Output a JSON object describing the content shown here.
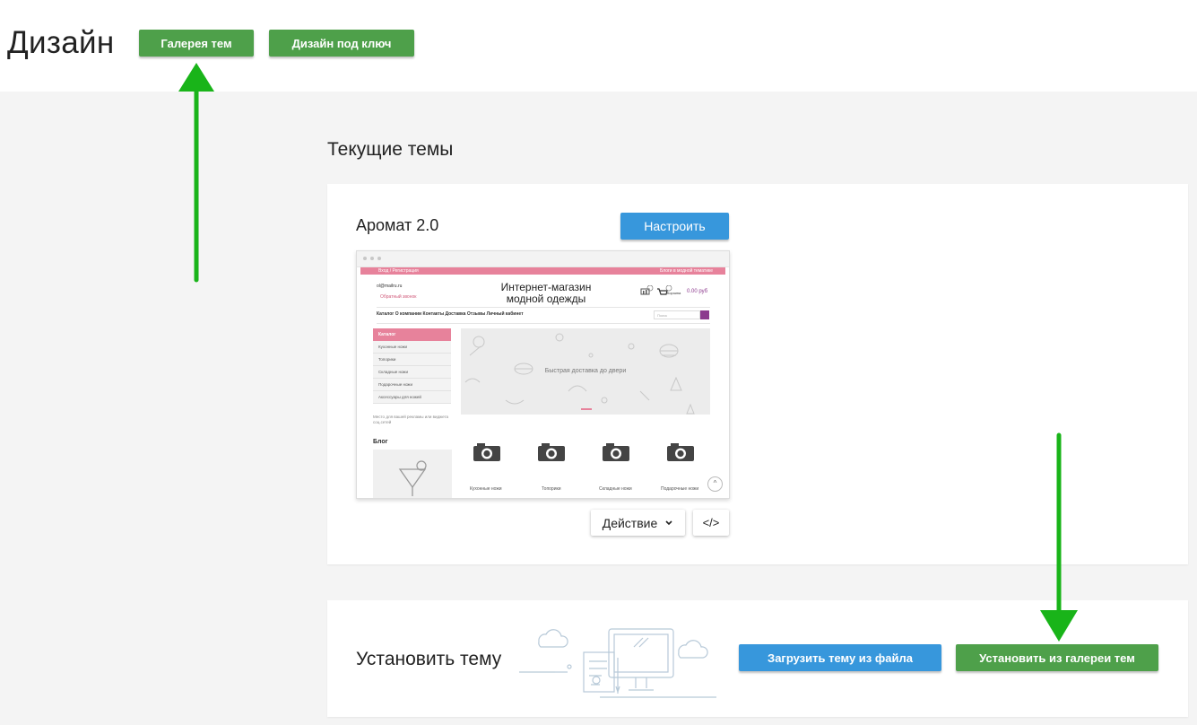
{
  "header": {
    "title": "Дизайн",
    "gallery_button": "Галерея тем",
    "turnkey_button": "Дизайн под ключ"
  },
  "current_themes": {
    "section_title": "Текущие темы",
    "theme_name": "Аромат 2.0",
    "configure_button": "Настроить",
    "action_button": "Действие",
    "code_button": "</>",
    "preview": {
      "topbar_left": "Вход / Регистрация",
      "topbar_right": "Блоги в модной тематике",
      "email": "ol@mailru.ru",
      "callback": "Обратный звонок",
      "shop_title": "Интернет-магазин модной одежды",
      "cart_label": "Корзина",
      "cart_total": "0.00 руб",
      "menu": "Каталог   О компании   Контакты   Доставка   Отзывы   Личный кабинет",
      "search_placeholder": "Поиск",
      "catalog_head": "Каталог",
      "categories": [
        "Кухонные ножи",
        "Топорики",
        "Складные ножи",
        "Подарочные ножи",
        "Аксессуары для ножей"
      ],
      "banner_text": "Быстрая доставка до двери",
      "ad_text": "Место для вашей рекламы или виджета соц.сетей",
      "blog_title": "Блог",
      "products": [
        "Кухонные ножи",
        "Топорики",
        "Складные ножи",
        "Подарочные ножи"
      ]
    }
  },
  "install": {
    "title": "Установить тему",
    "upload_button": "Загрузить тему из файла",
    "gallery_install_button": "Установить из галереи тем"
  },
  "colors": {
    "green": "#4ea04a",
    "blue": "#3797dc",
    "arrow": "#19b419",
    "pink": "#e7829b"
  }
}
